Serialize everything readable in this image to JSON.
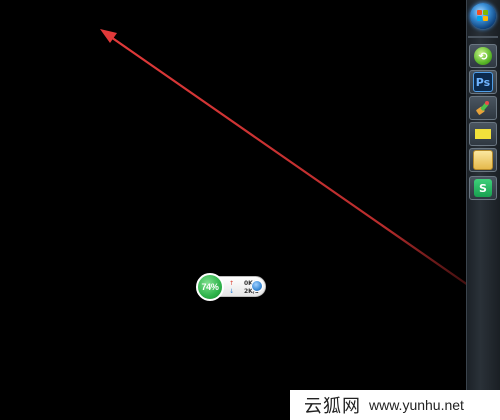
{
  "desktop": {
    "background": "#000000"
  },
  "annotation": {
    "color": "#e23a3a",
    "shape": "arrow"
  },
  "taskbar": {
    "start_button": {
      "icon": "windows-orb-icon"
    },
    "pinned": [
      {
        "name": "green-refresh-app",
        "icon": "green-circle-arrow-icon",
        "glyph": "⟲"
      },
      {
        "name": "photoshop",
        "icon": "photoshop-icon",
        "glyph": "Ps"
      },
      {
        "name": "paint-tool",
        "icon": "paint-brush-icon",
        "glyph": ""
      },
      {
        "name": "notes-app",
        "icon": "yellow-lines-icon",
        "glyph": ""
      },
      {
        "name": "file-explorer",
        "icon": "folder-icon",
        "glyph": ""
      },
      {
        "name": "wps-app",
        "icon": "wps-s-icon",
        "glyph": "S"
      }
    ]
  },
  "net_widget": {
    "percent": "74%",
    "upload_arrow": "↑",
    "upload_speed": "0K/s",
    "download_arrow": "↓",
    "download_speed": "2K/s",
    "accent": "#2fb44b"
  },
  "watermark": {
    "brand_cn": "云狐网",
    "url": "www.yunhu.net"
  }
}
